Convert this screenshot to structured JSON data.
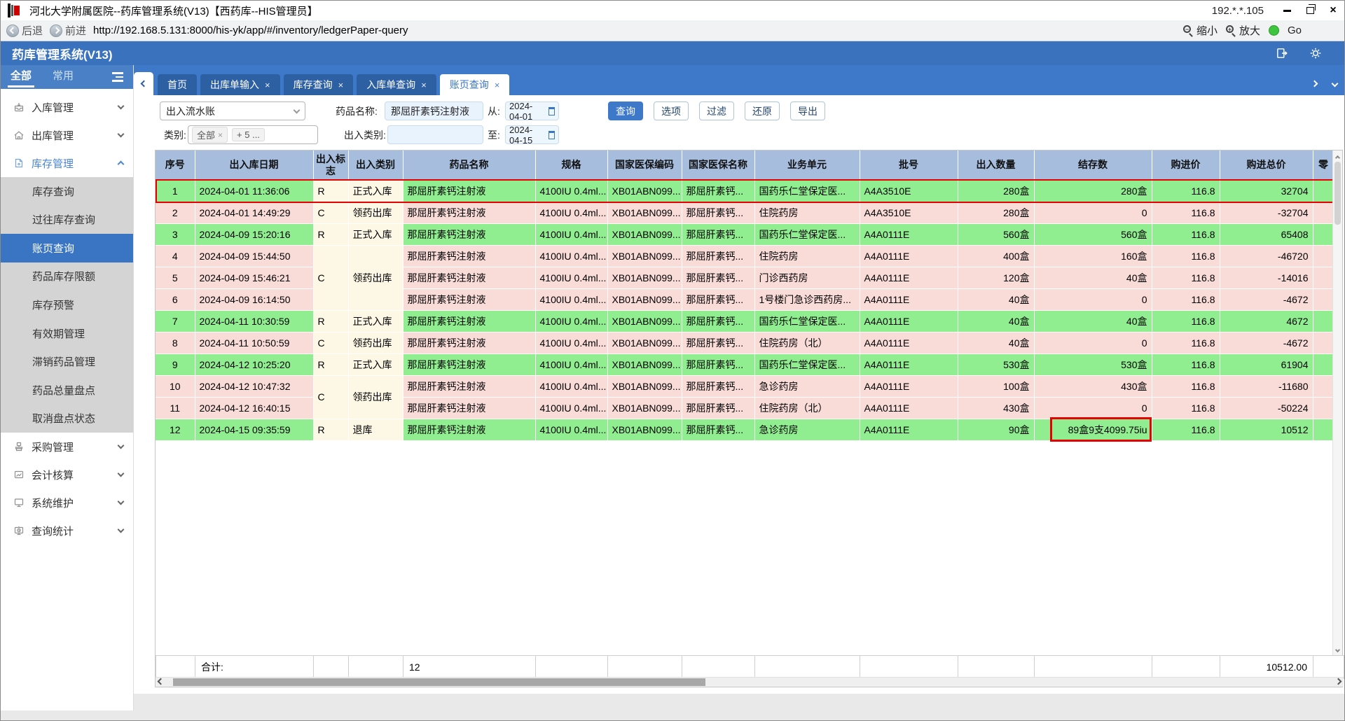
{
  "window": {
    "title": "河北大学附属医院--药库管理系统(V13)【西药库--HIS管理员】",
    "ip": "192.*.*.105"
  },
  "address": {
    "back": "后退",
    "forward": "前进",
    "url": "http://192.168.5.131:8000/his-yk/app/#/inventory/ledgerPaper-query",
    "zoom_out": "缩小",
    "zoom_in": "放大",
    "go": "Go"
  },
  "header": {
    "title": "药库管理系统(V13)"
  },
  "sidebar": {
    "tabs": [
      {
        "label": "全部",
        "active": true
      },
      {
        "label": "常用",
        "active": false
      }
    ],
    "groups": [
      {
        "label": "入库管理",
        "icon": "inbox-icon",
        "expanded": false
      },
      {
        "label": "出库管理",
        "icon": "warehouse-icon",
        "expanded": false
      },
      {
        "label": "库存管理",
        "icon": "inventory-doc-icon",
        "expanded": true,
        "children": [
          "库存查询",
          "过往库存查询",
          "账页查询",
          "药品库存限额",
          "库存预警",
          "有效期管理",
          "滞销药品管理",
          "药品总量盘点",
          "取消盘点状态"
        ],
        "active_child": "账页查询"
      },
      {
        "label": "采购管理",
        "icon": "purchase-icon",
        "expanded": false
      },
      {
        "label": "会计核算",
        "icon": "accounting-icon",
        "expanded": false
      },
      {
        "label": "系统维护",
        "icon": "system-icon",
        "expanded": false
      },
      {
        "label": "查询统计",
        "icon": "stats-icon",
        "expanded": false
      }
    ]
  },
  "tabs": [
    {
      "label": "首页",
      "closable": false,
      "active": false
    },
    {
      "label": "出库单输入",
      "closable": true,
      "active": false
    },
    {
      "label": "库存查询",
      "closable": true,
      "active": false
    },
    {
      "label": "入库单查询",
      "closable": true,
      "active": false
    },
    {
      "label": "账页查询",
      "closable": true,
      "active": true
    }
  ],
  "filters": {
    "report_type": "出入流水账",
    "drug_label": "药品名称:",
    "drug_value": "那屈肝素钙注射液",
    "from_label": "从:",
    "from_value": "2024-04-01",
    "to_label": "至:",
    "to_value": "2024-04-15",
    "category_label": "类别:",
    "category_tags": [
      {
        "label": "全部",
        "removable": true
      },
      {
        "label": "+ 5 ...",
        "removable": false
      }
    ],
    "inout_label": "出入类别:",
    "inout_value": "",
    "buttons": [
      {
        "label": "查询",
        "primary": true
      },
      {
        "label": "选项",
        "primary": false
      },
      {
        "label": "过滤",
        "primary": false
      },
      {
        "label": "还原",
        "primary": false
      },
      {
        "label": "导出",
        "primary": false
      }
    ]
  },
  "table": {
    "columns": [
      "序号",
      "出入库日期",
      "出入标志",
      "出入类别",
      "药品名称",
      "规格",
      "国家医保编码",
      "国家医保名称",
      "业务单元",
      "批号",
      "出入数量",
      "结存数",
      "购进价",
      "购进总价",
      "零"
    ],
    "rows": [
      {
        "seq": "1",
        "date": "2024-04-01 11:36:06",
        "flag": "R",
        "flag_span": 1,
        "category": "正式入库",
        "category_span": 1,
        "drug": "那屈肝素钙注射液",
        "spec": "4100IU 0.4ml...",
        "code": "XB01ABN099...",
        "iname": "那屈肝素钙...",
        "unit": "国药乐仁堂保定医...",
        "batch": "A4A3510E",
        "qty": "280盒",
        "balance": "280盒",
        "price": "116.8",
        "total": "32704",
        "type": "in",
        "selected": true,
        "balance_boxed": false
      },
      {
        "seq": "2",
        "date": "2024-04-01 14:49:29",
        "flag": "C",
        "flag_span": 1,
        "category": "领药出库",
        "category_span": 1,
        "drug": "那屈肝素钙注射液",
        "spec": "4100IU 0.4ml...",
        "code": "XB01ABN099...",
        "iname": "那屈肝素钙...",
        "unit": "住院药房",
        "batch": "A4A3510E",
        "qty": "280盒",
        "balance": "0",
        "price": "116.8",
        "total": "-32704",
        "type": "out",
        "selected": false,
        "balance_boxed": false
      },
      {
        "seq": "3",
        "date": "2024-04-09 15:20:16",
        "flag": "R",
        "flag_span": 1,
        "category": "正式入库",
        "category_span": 1,
        "drug": "那屈肝素钙注射液",
        "spec": "4100IU 0.4ml...",
        "code": "XB01ABN099...",
        "iname": "那屈肝素钙...",
        "unit": "国药乐仁堂保定医...",
        "batch": "A4A0111E",
        "qty": "560盒",
        "balance": "560盒",
        "price": "116.8",
        "total": "65408",
        "type": "in",
        "selected": false,
        "balance_boxed": false
      },
      {
        "seq": "4",
        "date": "2024-04-09 15:44:50",
        "flag": "C",
        "flag_span": 3,
        "category": "领药出库",
        "category_span": 3,
        "drug": "那屈肝素钙注射液",
        "spec": "4100IU 0.4ml...",
        "code": "XB01ABN099...",
        "iname": "那屈肝素钙...",
        "unit": "住院药房",
        "batch": "A4A0111E",
        "qty": "400盒",
        "balance": "160盒",
        "price": "116.8",
        "total": "-46720",
        "type": "out",
        "selected": false,
        "balance_boxed": false
      },
      {
        "seq": "5",
        "date": "2024-04-09 15:46:21",
        "flag": null,
        "flag_span": 0,
        "category": null,
        "category_span": 0,
        "drug": "那屈肝素钙注射液",
        "spec": "4100IU 0.4ml...",
        "code": "XB01ABN099...",
        "iname": "那屈肝素钙...",
        "unit": "门诊西药房",
        "batch": "A4A0111E",
        "qty": "120盒",
        "balance": "40盒",
        "price": "116.8",
        "total": "-14016",
        "type": "out",
        "selected": false,
        "balance_boxed": false
      },
      {
        "seq": "6",
        "date": "2024-04-09 16:14:50",
        "flag": null,
        "flag_span": 0,
        "category": null,
        "category_span": 0,
        "drug": "那屈肝素钙注射液",
        "spec": "4100IU 0.4ml...",
        "code": "XB01ABN099...",
        "iname": "那屈肝素钙...",
        "unit": "1号楼门急诊西药房...",
        "batch": "A4A0111E",
        "qty": "40盒",
        "balance": "0",
        "price": "116.8",
        "total": "-4672",
        "type": "out",
        "selected": false,
        "balance_boxed": false
      },
      {
        "seq": "7",
        "date": "2024-04-11 10:30:59",
        "flag": "R",
        "flag_span": 1,
        "category": "正式入库",
        "category_span": 1,
        "drug": "那屈肝素钙注射液",
        "spec": "4100IU 0.4ml...",
        "code": "XB01ABN099...",
        "iname": "那屈肝素钙...",
        "unit": "国药乐仁堂保定医...",
        "batch": "A4A0111E",
        "qty": "40盒",
        "balance": "40盒",
        "price": "116.8",
        "total": "4672",
        "type": "in",
        "selected": false,
        "balance_boxed": false
      },
      {
        "seq": "8",
        "date": "2024-04-11 10:50:59",
        "flag": "C",
        "flag_span": 1,
        "category": "领药出库",
        "category_span": 1,
        "drug": "那屈肝素钙注射液",
        "spec": "4100IU 0.4ml...",
        "code": "XB01ABN099...",
        "iname": "那屈肝素钙...",
        "unit": "住院药房（北）",
        "batch": "A4A0111E",
        "qty": "40盒",
        "balance": "0",
        "price": "116.8",
        "total": "-4672",
        "type": "out",
        "selected": false,
        "balance_boxed": false
      },
      {
        "seq": "9",
        "date": "2024-04-12 10:25:20",
        "flag": "R",
        "flag_span": 1,
        "category": "正式入库",
        "category_span": 1,
        "drug": "那屈肝素钙注射液",
        "spec": "4100IU 0.4ml...",
        "code": "XB01ABN099...",
        "iname": "那屈肝素钙...",
        "unit": "国药乐仁堂保定医...",
        "batch": "A4A0111E",
        "qty": "530盒",
        "balance": "530盒",
        "price": "116.8",
        "total": "61904",
        "type": "in",
        "selected": false,
        "balance_boxed": false
      },
      {
        "seq": "10",
        "date": "2024-04-12 10:47:32",
        "flag": "C",
        "flag_span": 2,
        "category": "领药出库",
        "category_span": 2,
        "drug": "那屈肝素钙注射液",
        "spec": "4100IU 0.4ml...",
        "code": "XB01ABN099...",
        "iname": "那屈肝素钙...",
        "unit": "急诊药房",
        "batch": "A4A0111E",
        "qty": "100盒",
        "balance": "430盒",
        "price": "116.8",
        "total": "-11680",
        "type": "out",
        "selected": false,
        "balance_boxed": false
      },
      {
        "seq": "11",
        "date": "2024-04-12 16:40:15",
        "flag": null,
        "flag_span": 0,
        "category": null,
        "category_span": 0,
        "drug": "那屈肝素钙注射液",
        "spec": "4100IU 0.4ml...",
        "code": "XB01ABN099...",
        "iname": "那屈肝素钙...",
        "unit": "住院药房（北）",
        "batch": "A4A0111E",
        "qty": "430盒",
        "balance": "0",
        "price": "116.8",
        "total": "-50224",
        "type": "out",
        "selected": false,
        "balance_boxed": false
      },
      {
        "seq": "12",
        "date": "2024-04-15 09:35:59",
        "flag": "R",
        "flag_span": 1,
        "category": "退库",
        "category_span": 1,
        "drug": "那屈肝素钙注射液",
        "spec": "4100IU 0.4ml...",
        "code": "XB01ABN099...",
        "iname": "那屈肝素钙...",
        "unit": "急诊药房",
        "batch": "A4A0111E",
        "qty": "90盒",
        "balance": "89盒9支4099.75iu",
        "price": "116.8",
        "total": "10512",
        "type": "in",
        "selected": false,
        "balance_boxed": true
      }
    ],
    "footer": {
      "label": "合计:",
      "count": "12",
      "total": "10512.00"
    }
  }
}
